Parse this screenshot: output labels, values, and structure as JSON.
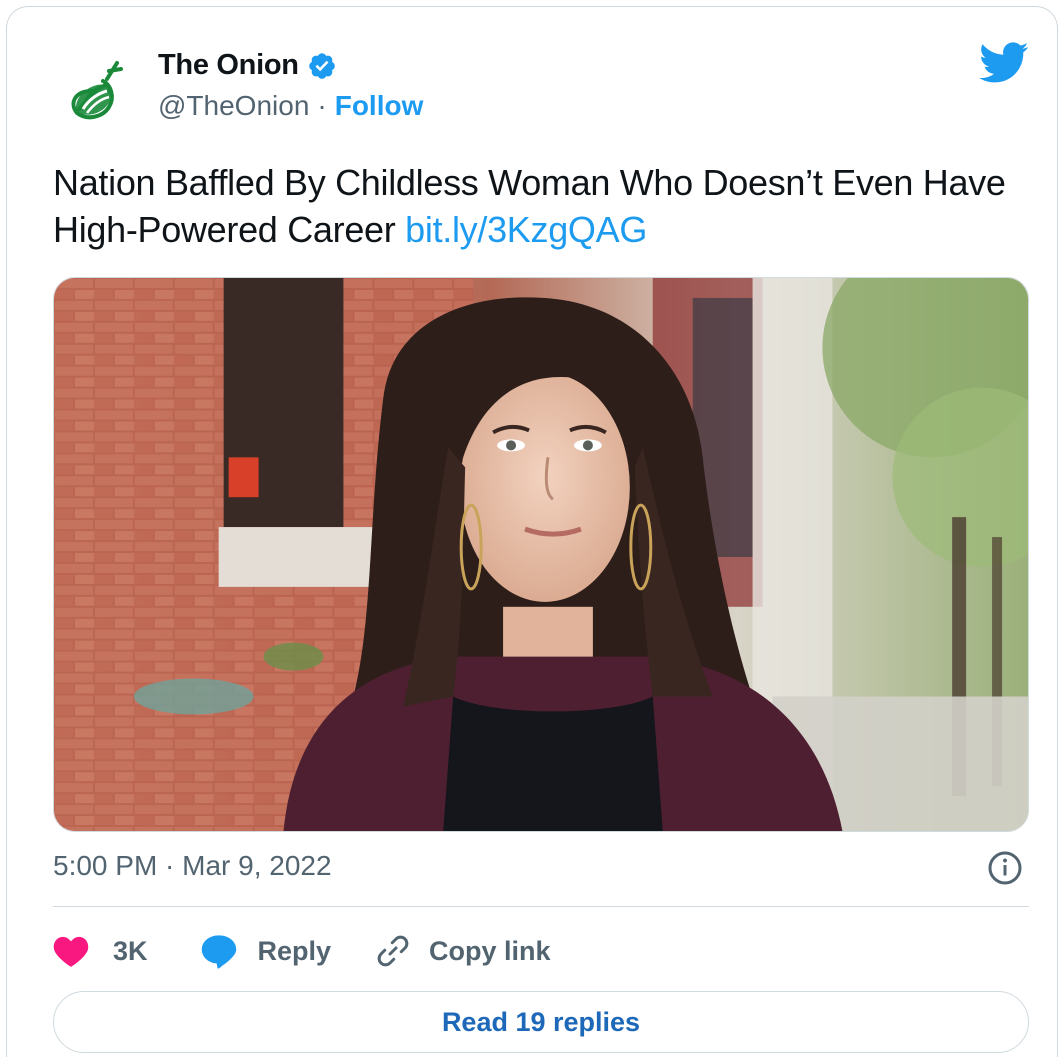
{
  "author": {
    "name": "The Onion",
    "handle": "@TheOnion",
    "separator": "·",
    "follow_label": "Follow"
  },
  "tweet": {
    "text": "Nation Baffled By Childless Woman Who Doesn’t Even Have High-Powered Career ",
    "link": "bit.ly/3KzgQAG",
    "media_alt": "Photo of a woman with shoulder-length dark hair and hoop earrings standing on a city sidewalk"
  },
  "meta": {
    "timestamp": "5:00 PM · Mar 9, 2022"
  },
  "actions": {
    "like_count": "3K",
    "reply_label": "Reply",
    "copy_label": "Copy link"
  },
  "read_replies_label": "Read 19 replies",
  "colors": {
    "accent": "#1d9bf0",
    "like": "#f91880",
    "text": "#0f1419",
    "muted": "#536471",
    "border": "#cfd9de",
    "onion_green": "#1a8a3a"
  },
  "icons": {
    "avatar": "onion-logo-icon",
    "verified": "verified-badge-icon",
    "brand": "twitter-bird-icon",
    "info": "info-icon",
    "like": "heart-icon",
    "reply": "reply-bubble-icon",
    "copy": "link-icon"
  }
}
